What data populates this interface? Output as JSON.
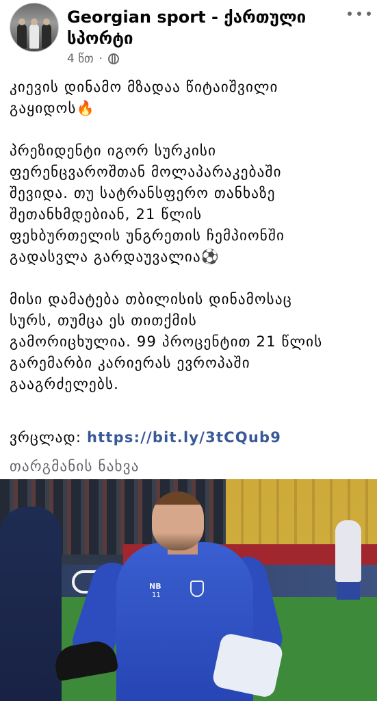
{
  "post": {
    "page_name": "Georgian sport - ქართული სპორტი",
    "time": "4 წთ",
    "separator": "·",
    "paragraphs": [
      [
        "კიევის დინამო მზადაა წიტაიშვილი",
        "გაყიდოს🔥"
      ],
      [
        "პრეზიდენტი იგორ სურკისი",
        "ფერენცვაროშთან მოლაპარაკებაში",
        "შევიდა. თუ  სატრანსფერო თანხაზე",
        "შეთანხმდებიან, 21 წლის",
        "ფეხბურთელის უნგრეთის ჩემპიონში",
        "გადასვლა გარდაუვალია⚽"
      ],
      [
        "მისი დამატება თბილისის დინამოსაც",
        "სურს, თუმცა ეს თითქმის",
        "გამორიცხულია. 99 პროცენტით 21 წლის",
        "გარემარბი კარიერას ევროპაში",
        "გააგრძელებს."
      ]
    ],
    "link_label": "ვრცლად: ",
    "link_url": "https://bit.ly/3tCQub9",
    "translate": "თარგმანის ნახვა"
  },
  "photo": {
    "shirt_number": "11",
    "kit_brand": "NB"
  }
}
